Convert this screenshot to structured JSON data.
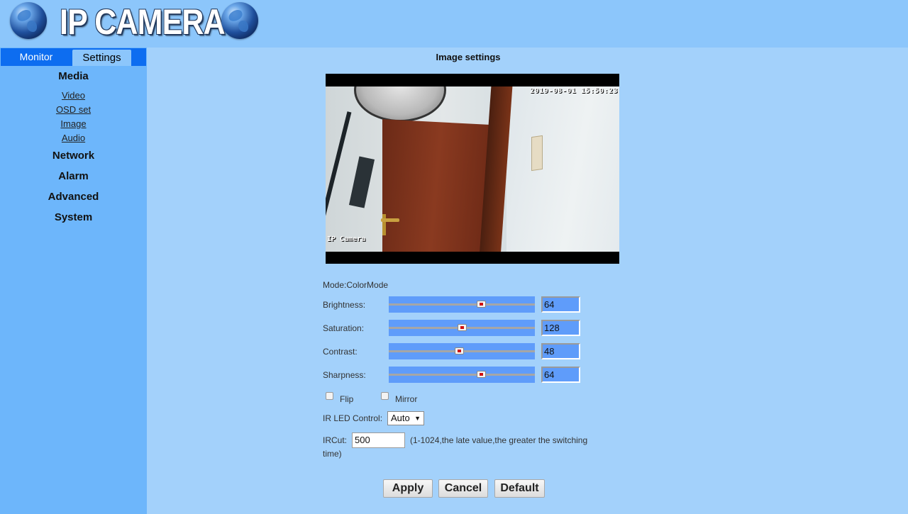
{
  "header": {
    "title": "IP CAMERA",
    "icons": [
      "globe-icon",
      "globe-icon"
    ]
  },
  "nav": {
    "tabs": [
      {
        "label": "Monitor",
        "active": false
      },
      {
        "label": "Settings",
        "active": true
      }
    ],
    "sections": [
      {
        "label": "Media",
        "items": [
          "Video",
          "OSD set",
          "Image",
          "Audio"
        ]
      },
      {
        "label": "Network"
      },
      {
        "label": "Alarm"
      },
      {
        "label": "Advanced"
      },
      {
        "label": "System"
      }
    ]
  },
  "page": {
    "title": "Image settings"
  },
  "preview": {
    "timestamp": "2019-08-01 15:50:23",
    "camera_name": "IP Camera"
  },
  "settings": {
    "mode_label": "Mode:ColorMode",
    "sliders": [
      {
        "label": "Brightness:",
        "value": "64",
        "fraction": 0.63
      },
      {
        "label": "Saturation:",
        "value": "128",
        "fraction": 0.5
      },
      {
        "label": "Contrast:",
        "value": "48",
        "fraction": 0.48
      },
      {
        "label": "Sharpness:",
        "value": "64",
        "fraction": 0.63
      }
    ],
    "flip_label": "Flip",
    "mirror_label": "Mirror",
    "ir_led_label": "IR LED Control:",
    "ir_led_value": "Auto",
    "ircut_label": "IRCut:",
    "ircut_value": "500",
    "ircut_hint_1": "(1-1024,the late value,the greater the switching",
    "ircut_hint_2": "time)"
  },
  "buttons": {
    "apply": "Apply",
    "cancel": "Cancel",
    "default": "Default"
  },
  "colors": {
    "page_bg": "#a3d1fb",
    "sidebar_bg": "#6db6fb",
    "tab_bar": "#0d6df0",
    "slider_bg": "#5f9cfa"
  }
}
